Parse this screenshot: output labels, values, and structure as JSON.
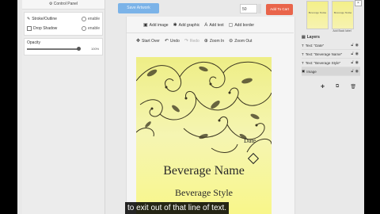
{
  "control_panel": {
    "title": "Control Panel",
    "stroke_label": "Stroke/Outline",
    "stroke_enable": "enable",
    "shadow_label": "Drop Shadow",
    "shadow_enable": "enable",
    "opacity_label": "Opacity",
    "opacity_value": "100%"
  },
  "top_bar": {
    "blue_button_label": "Save Artwork",
    "quantity": "50",
    "cart_label": "Add To Cart"
  },
  "toolbar": {
    "add_image": "Add image",
    "add_graphic": "Add graphic",
    "add_text": "Add text",
    "add_border": "Add border",
    "start_over": "Start Over",
    "undo": "Undo",
    "redo": "Redo",
    "zoom_in": "Zoom In",
    "zoom_out": "Zoom Out"
  },
  "label": {
    "date": "Date",
    "beverage_name": "Beverage Name",
    "beverage_style": "Beverage Style"
  },
  "caption": "to exit out of that line of text.",
  "right_panel": {
    "thumb1_text": "Beverage Name",
    "thumb2_text": "Beverage Name",
    "thumb2_caption": "Add Back label",
    "layers_title": "Layers",
    "layers": [
      {
        "label": "Text: \"Date\""
      },
      {
        "label": "Text: \"Beverage Name\""
      },
      {
        "label": "Text: \"Beverage Style\""
      },
      {
        "label": "Image"
      }
    ]
  },
  "colors": {
    "accent_blue": "#7bb3e8",
    "cart_orange": "#e9644a",
    "label_yellow": "#f3f29a"
  }
}
